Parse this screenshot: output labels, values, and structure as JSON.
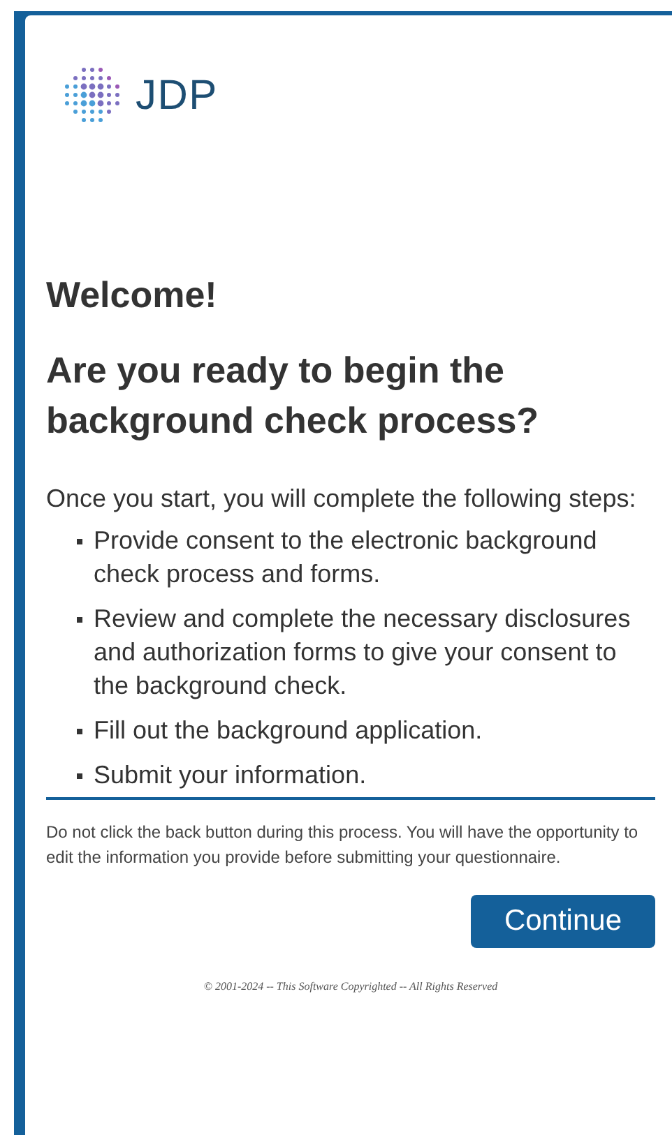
{
  "logo": {
    "text": "JDP"
  },
  "welcome": "Welcome!",
  "heading": "Are you ready to begin the background check process?",
  "intro": "Once you start, you will complete the following steps:",
  "steps": [
    "Provide consent to the electronic background check process and forms.",
    "Review and complete the necessary disclosures and authorization forms to give your consent to the background check.",
    "Fill out the background application.",
    "Submit your information."
  ],
  "notice": "Do not click the back button during this process. You will have the opportunity to edit the information you provide before submitting your questionnaire.",
  "buttons": [
    "Continue"
  ],
  "footer": "© 2001-2024 -- This Software Copyrighted -- All Rights Reserved"
}
